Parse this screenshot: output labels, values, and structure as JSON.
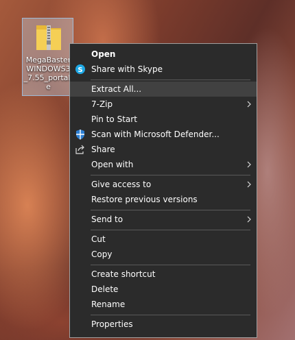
{
  "desktop": {
    "file": {
      "name_lines": [
        "MegaBaster",
        "WINDOWS3",
        "_7.55_portab",
        "e"
      ],
      "icon": "zip-folder-icon"
    }
  },
  "context_menu": {
    "items": [
      {
        "label": "Open",
        "icon": null
      },
      {
        "label": "Share with Skype",
        "icon": "skype-icon"
      },
      {
        "label": "Extract All...",
        "icon": null
      },
      {
        "label": "7-Zip",
        "icon": null
      },
      {
        "label": "Pin to Start",
        "icon": null
      },
      {
        "label": "Scan with Microsoft Defender...",
        "icon": "defender-shield-icon"
      },
      {
        "label": "Share",
        "icon": "share-icon"
      },
      {
        "label": "Open with",
        "icon": null
      },
      {
        "label": "Give access to",
        "icon": null
      },
      {
        "label": "Restore previous versions",
        "icon": null
      },
      {
        "label": "Send to",
        "icon": null
      },
      {
        "label": "Cut",
        "icon": null
      },
      {
        "label": "Copy",
        "icon": null
      },
      {
        "label": "Create shortcut",
        "icon": null
      },
      {
        "label": "Delete",
        "icon": null
      },
      {
        "label": "Rename",
        "icon": null
      },
      {
        "label": "Properties",
        "icon": null
      }
    ],
    "highlighted_item": "Extract All...",
    "colors": {
      "background": "#2b2b2b",
      "highlight": "#414141",
      "text": "#ffffff",
      "separator": "#5a5a5a"
    }
  }
}
